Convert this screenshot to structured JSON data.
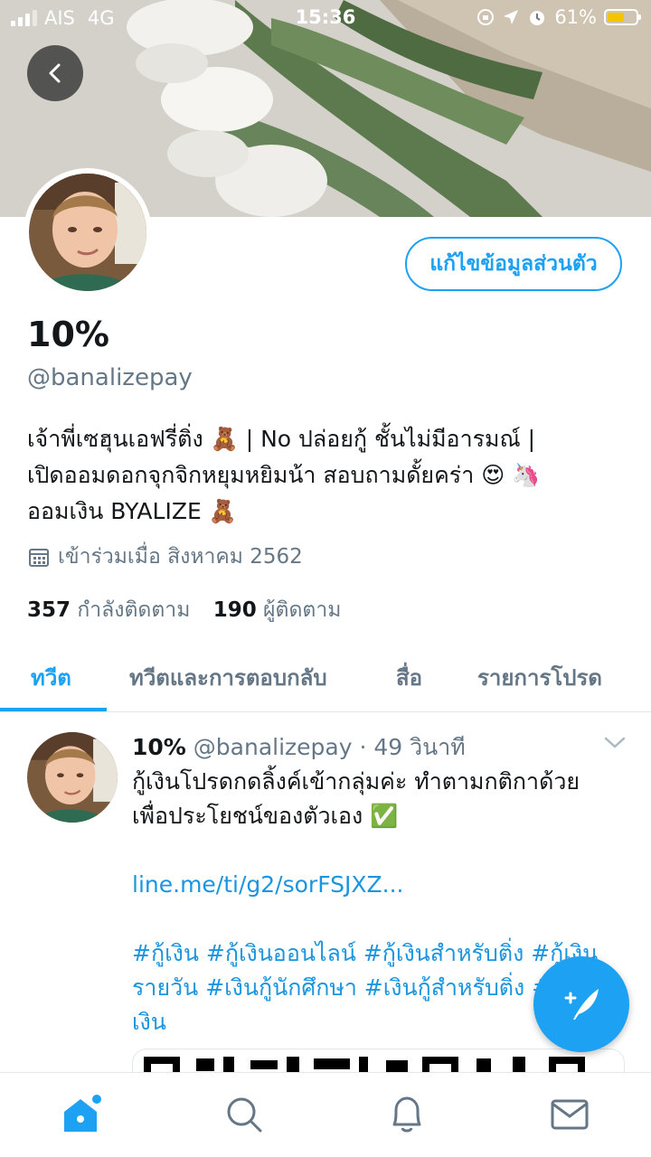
{
  "status_bar": {
    "carrier": "AIS",
    "network": "4G",
    "time": "15:36",
    "battery": "61%",
    "battery_level": 0.61,
    "battery_color": "#f5c400"
  },
  "profile": {
    "display_name": "10%",
    "handle": "@banalizepay",
    "edit_button": "แก้ไขข้อมูลส่วนตัว",
    "bio_line1": "เจ้าพี่เซฮุนเอฟรี่ติ่ง 🧸 | No ปล่อยกู้ ชั้นไม่มีอารมณ์ |",
    "bio_line2": "เปิดออมดอกจุกจิกหยุมหยิมน้า สอบถามดั้ยคร่า 😍 🦄",
    "bio_line3": "ออมเงิน BYALIZE 🧸",
    "joined_text": "เข้าร่วมเมื่อ สิงหาคม 2562",
    "following_count": "357",
    "following_label": "กำลังติดตาม",
    "followers_count": "190",
    "followers_label": "ผู้ติดตาม"
  },
  "tabs": [
    {
      "label": "ทวีต",
      "active": true
    },
    {
      "label": "ทวีตและการตอบกลับ",
      "active": false
    },
    {
      "label": "สื่อ",
      "active": false
    },
    {
      "label": "รายการโปรด",
      "active": false
    }
  ],
  "tweet": {
    "name": "10%",
    "handle": "@banalizepay",
    "time": "· 49 วินาที",
    "text_line1": "กู้เงินโปรดกดลิ้งค์เข้ากลุ่มค่ะ ทำตามกติกาด้วย",
    "text_line2": "เพื่อประโยชน์ของตัวเอง ✅",
    "link": "line.me/ti/g2/sorFSJXZ...",
    "hashtags_line1": "#กู้เงิน #กู้เงินออนไลน์ #กู้เงินสำหรับติ่ง #กู้เงิน",
    "hashtags_line2": "รายวัน #เงินกู้นักศึกษา #เงินกู้สำหรับติ่ง #กู้",
    "hashtags_line3": "เงิน"
  },
  "colors": {
    "accent": "#1da1f2",
    "text": "#14171a",
    "muted": "#657786"
  },
  "icons": {
    "back": "chevron-left-icon",
    "calendar": "calendar-icon",
    "compose": "compose-tweet-icon",
    "home": "home-icon",
    "search": "search-icon",
    "notifications": "bell-icon",
    "messages": "mail-icon",
    "more": "chevron-down-icon"
  }
}
